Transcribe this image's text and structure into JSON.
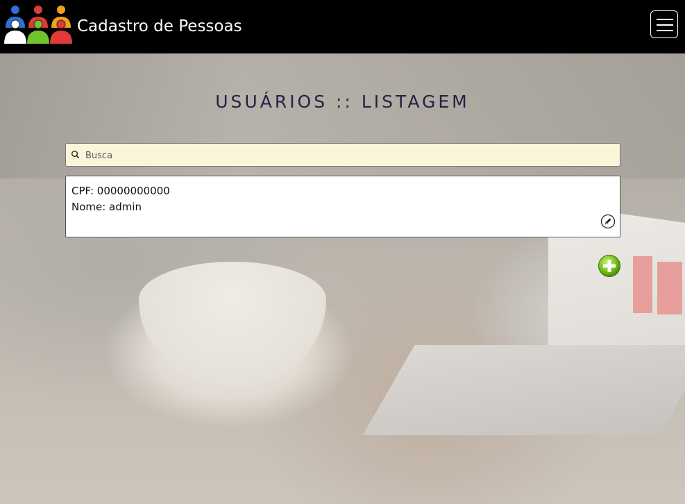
{
  "header": {
    "brand": "Cadastro de Pessoas",
    "logo_icon": "people-group-icon",
    "menu_icon": "hamburger-menu-icon"
  },
  "main": {
    "title": "USUÁRIOS :: LISTAGEM",
    "search": {
      "placeholder": "Busca",
      "value": "",
      "icon": "search-icon"
    },
    "users": [
      {
        "cpf_label": "CPF: 00000000000",
        "nome_label": "Nome: admin",
        "edit_icon": "pencil-icon"
      }
    ],
    "add_icon": "plus-circle-icon"
  },
  "colors": {
    "navbar": "#000000",
    "title": "#1f2440",
    "search_bg": "#fbf6d9",
    "add_green": "#7bc41c",
    "logo_blue": "#2f6fd6",
    "logo_green": "#6fc52b",
    "logo_red": "#e03a3a",
    "logo_orange": "#f0a21a"
  }
}
